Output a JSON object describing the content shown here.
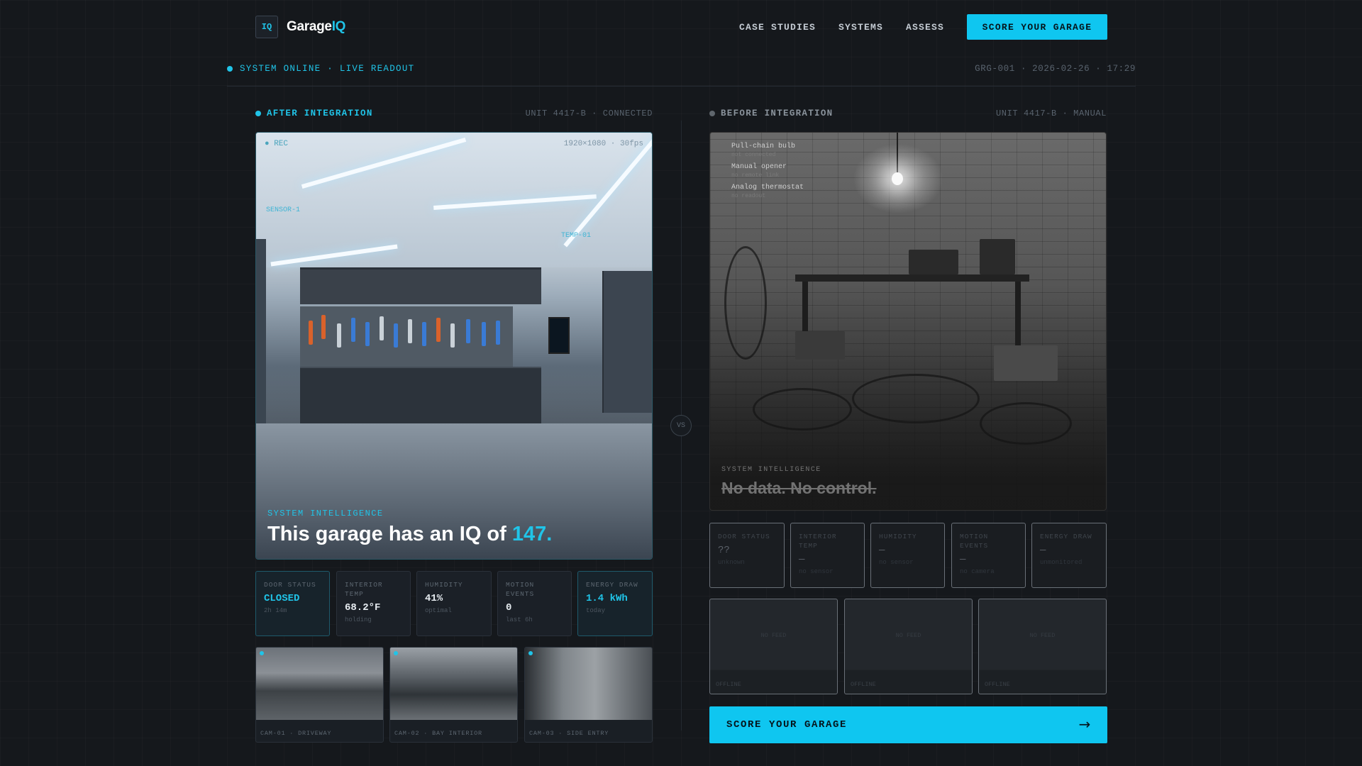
{
  "brand": {
    "logo_badge": "IQ",
    "name_prefix": "Garage",
    "name_accent": "IQ"
  },
  "nav": {
    "items": [
      "CASE STUDIES",
      "SYSTEMS",
      "ASSESS"
    ],
    "cta": "SCORE YOUR GARAGE"
  },
  "status": {
    "left": "SYSTEM ONLINE · LIVE READOUT",
    "right": "GRG-001 · 2026-02-26 · 17:29"
  },
  "after": {
    "label": "AFTER INTEGRATION",
    "meta": "UNIT 4417-B · CONNECTED",
    "rec": "● REC",
    "resolution": "1920×1080 · 30fps",
    "sensor_1": "SENSOR-1",
    "sensor_2": "TEMP-01",
    "caption": "SYSTEM INTELLIGENCE",
    "title_prefix": "This garage has an IQ of ",
    "iq_value": "147.",
    "metrics": [
      {
        "label": "DOOR STATUS",
        "value": "CLOSED",
        "sub": "2h 14m"
      },
      {
        "label": "INTERIOR TEMP",
        "value": "68.2°F",
        "sub": "holding"
      },
      {
        "label": "HUMIDITY",
        "value": "41%",
        "sub": "optimal"
      },
      {
        "label": "MOTION EVENTS",
        "value": "0",
        "sub": "last 6h"
      },
      {
        "label": "ENERGY DRAW",
        "value": "1.4 kWh",
        "sub": "today"
      }
    ],
    "cameras": [
      "CAM-01 · DRIVEWAY",
      "CAM-02 · BAY INTERIOR",
      "CAM-03 · SIDE ENTRY"
    ]
  },
  "before": {
    "label": "BEFORE INTEGRATION",
    "meta": "UNIT 4417-B · MANUAL",
    "notes": [
      {
        "title": "Pull-chain bulb",
        "sub": "not connected"
      },
      {
        "title": "Manual opener",
        "sub": "no remote link"
      },
      {
        "title": "Analog thermostat",
        "sub": "no readout"
      }
    ],
    "caption": "SYSTEM INTELLIGENCE",
    "title": "No data. No control.",
    "metrics": [
      {
        "label": "DOOR STATUS",
        "value": "??",
        "sub": "unknown"
      },
      {
        "label": "INTERIOR TEMP",
        "value": "—",
        "sub": "no sensor"
      },
      {
        "label": "HUMIDITY",
        "value": "—",
        "sub": "no sensor"
      },
      {
        "label": "MOTION EVENTS",
        "value": "—",
        "sub": "no camera"
      },
      {
        "label": "ENERGY DRAW",
        "value": "—",
        "sub": "unmonitored"
      }
    ],
    "feeds": [
      {
        "mid": "NO FEED",
        "status": "OFFLINE"
      },
      {
        "mid": "NO FEED",
        "status": "OFFLINE"
      },
      {
        "mid": "NO FEED",
        "status": "OFFLINE"
      }
    ],
    "cta": "SCORE YOUR GARAGE",
    "cta_arrow": "→"
  },
  "vs": "VS",
  "colors": {
    "accent": "#0fc6f0",
    "background": "#15181c"
  }
}
